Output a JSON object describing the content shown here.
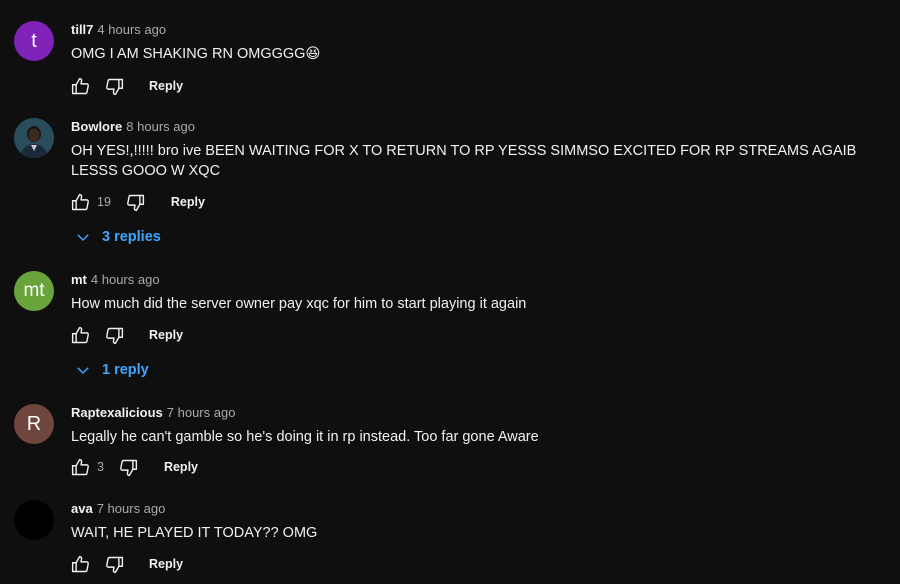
{
  "colors": {
    "background": "#0f0f0f",
    "text": "#f1f1f1",
    "secondary": "#aaaaaa",
    "link": "#3ea6ff"
  },
  "comments": [
    {
      "author": "till7",
      "time": "4 hours ago",
      "avatar_letter": "t",
      "avatar_color": "#7e22b8",
      "text": "OMG I AM SHAKING RN OMGGGG😆",
      "likes": "",
      "reply_label": "Reply"
    },
    {
      "author": "Bowlore",
      "time": "8 hours ago",
      "avatar_letter": "",
      "avatar_color": "#1d3a4a",
      "avatar_icon": "profile-photo",
      "text": "OH  YES!,!!!!! bro ive BEEN WAITING FOR X TO RETURN TO RP YESSS SIMMSO EXCITED FOR RP STREAMS AGAIB LESSS GOOO W XQC",
      "likes": "19",
      "reply_label": "Reply",
      "replies_label": "3 replies"
    },
    {
      "author": "mt",
      "time": "4 hours ago",
      "avatar_letter": "mt",
      "avatar_color": "#68a33c",
      "text": "How much did the server owner pay xqc for him to start playing it again",
      "likes": "",
      "reply_label": "Reply",
      "replies_label": "1 reply"
    },
    {
      "author": "Raptexalicious",
      "time": "7 hours ago",
      "avatar_letter": "R",
      "avatar_color": "#70473f",
      "text": "Legally he can't gamble so he's doing it in rp instead. Too far gone Aware",
      "likes": "3",
      "reply_label": "Reply"
    },
    {
      "author": "ava",
      "time": "7 hours ago",
      "avatar_letter": "",
      "avatar_color": "#000000",
      "text": "WAIT, HE PLAYED IT TODAY?? OMG",
      "likes": "",
      "reply_label": "Reply"
    }
  ]
}
